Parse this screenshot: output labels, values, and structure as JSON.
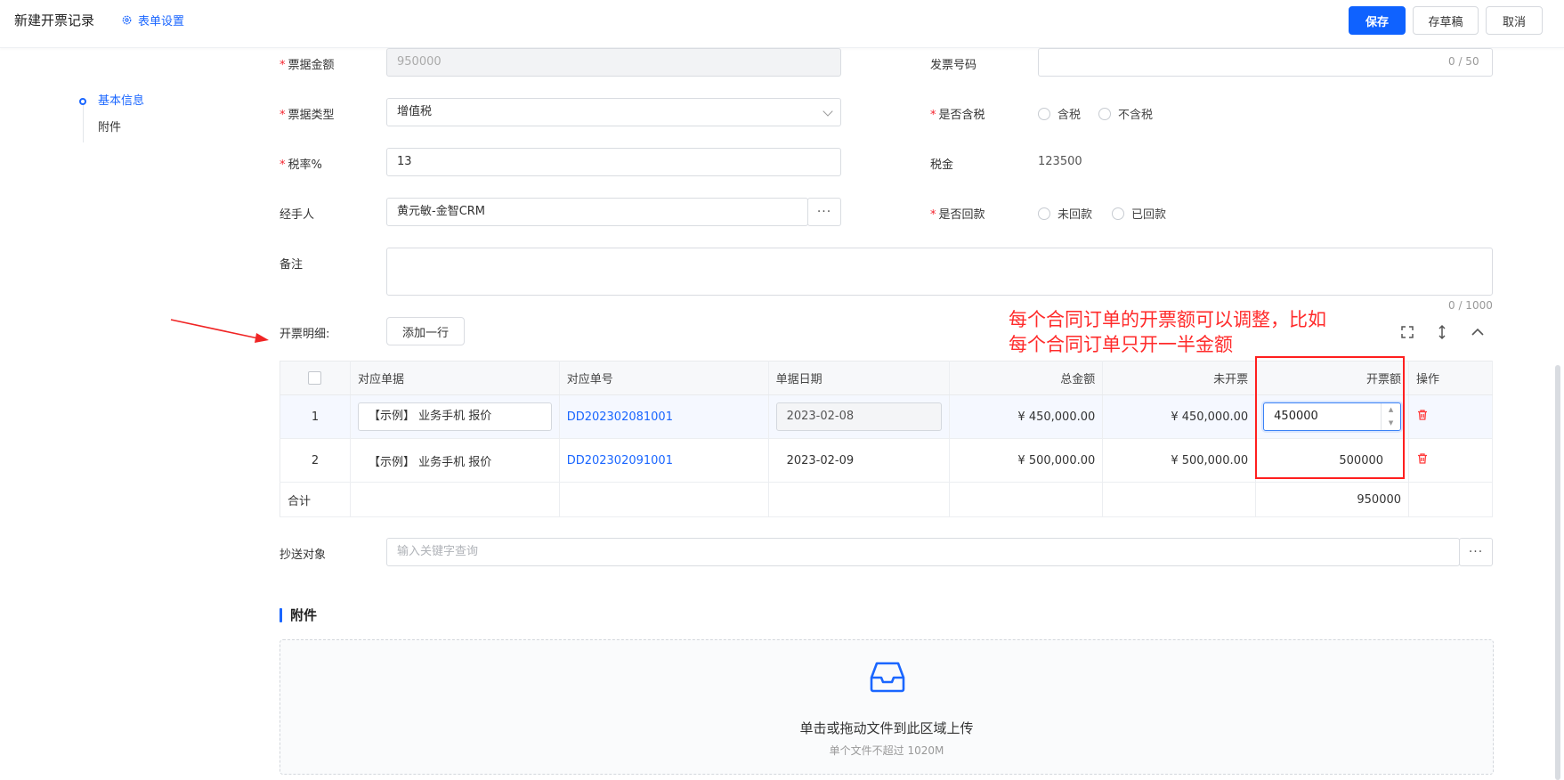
{
  "header": {
    "title": "新建开票记录",
    "form_settings": "表单设置",
    "save": "保存",
    "save_draft": "存草稿",
    "cancel": "取消"
  },
  "nav": {
    "items": [
      {
        "label": "基本信息"
      },
      {
        "label": "附件"
      }
    ]
  },
  "form": {
    "amount_label": "票据金额",
    "amount_value": "950000",
    "invoice_no_label": "发票号码",
    "invoice_no_counter": "0 / 50",
    "type_label": "票据类型",
    "type_value": "增值税",
    "tax_incl_label": "是否含税",
    "tax_incl_opt1": "含税",
    "tax_incl_opt2": "不含税",
    "rate_label": "税率%",
    "rate_value": "13",
    "tax_label": "税金",
    "tax_value": "123500",
    "handler_label": "经手人",
    "handler_value": "黄元敏-金智CRM",
    "paid_label": "是否回款",
    "paid_opt1": "未回款",
    "paid_opt2": "已回款",
    "remark_label": "备注",
    "remark_counter": "0 / 1000",
    "details_label": "开票明细:",
    "add_row": "添加一行",
    "cc_label": "抄送对象",
    "cc_placeholder": "输入关键字查询"
  },
  "annotation": {
    "line1": "每个合同订单的开票额可以调整，比如",
    "line2": "每个合同订单只开一半金额"
  },
  "table": {
    "headers": {
      "doc": "对应单据",
      "doc_no": "对应单号",
      "date": "单据日期",
      "total": "总金额",
      "unbilled": "未开票",
      "billed": "开票额",
      "ops": "操作"
    },
    "rows": [
      {
        "idx": "1",
        "doc": "【示例】 业务手机 报价",
        "doc_no": "DD202302081001",
        "date": "2023-02-08",
        "total": "¥ 450,000.00",
        "unbilled": "¥ 450,000.00",
        "billed": "450000"
      },
      {
        "idx": "2",
        "doc": "【示例】 业务手机 报价",
        "doc_no": "DD202302091001",
        "date": "2023-02-09",
        "total": "¥ 500,000.00",
        "unbilled": "¥ 500,000.00",
        "billed": "500000"
      }
    ],
    "total_label": "合计",
    "total_value": "950000"
  },
  "attachments": {
    "title": "附件",
    "upload_text": "单击或拖动文件到此区域上传",
    "upload_hint": "单个文件不超过 1020M"
  },
  "colors": {
    "primary": "#0f62ff",
    "annotation_red": "#ff1f1f"
  }
}
